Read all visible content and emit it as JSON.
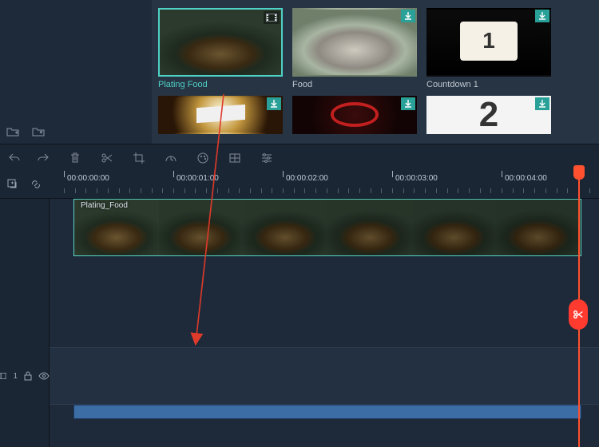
{
  "media": {
    "row1": [
      {
        "label": "Plating Food",
        "selected": true,
        "badge": "video"
      },
      {
        "label": "Food",
        "selected": false,
        "badge": "download"
      },
      {
        "label": "Countdown 1",
        "selected": false,
        "badge": "download"
      }
    ],
    "row2": [
      {
        "label": "",
        "badge": "download"
      },
      {
        "label": "",
        "badge": "download"
      },
      {
        "label": "",
        "badge": "download"
      }
    ]
  },
  "timeline": {
    "ticks": [
      "00:00:00:00",
      "00:00:01:00",
      "00:00:02:00",
      "00:00:03:00",
      "00:00:04:00"
    ],
    "clip_title": "Plating_Food",
    "track_label": "1"
  },
  "icons": {
    "undo": "undo-icon",
    "redo": "redo-icon",
    "delete": "trash-icon",
    "cut": "scissors-icon",
    "crop": "crop-icon",
    "speed": "speed-icon",
    "color": "palette-icon",
    "freeze": "freeze-icon",
    "adjust": "sliders-icon",
    "add_marker": "add-marker-icon",
    "link": "link-icon",
    "newfolder": "new-folder-icon",
    "importfolder": "import-folder-icon",
    "lock": "lock-icon",
    "eye": "eye-icon"
  },
  "colors": {
    "accent": "#4fd1c5",
    "playhead": "#ff512f",
    "cut": "#ff3b2f"
  }
}
